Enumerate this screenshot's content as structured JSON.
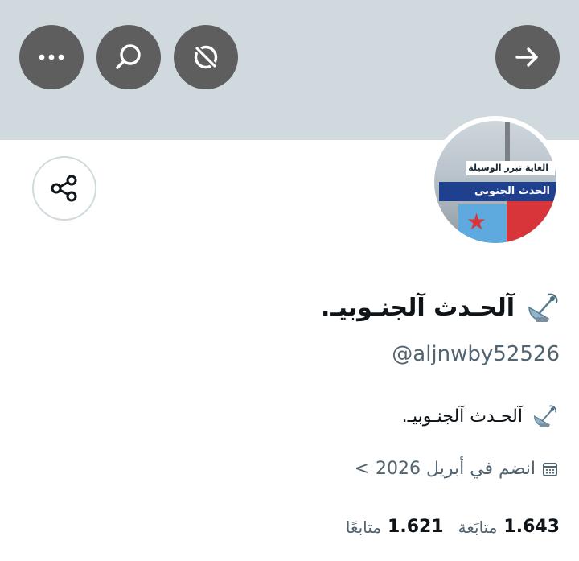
{
  "header": {
    "banner_color": "#cfd9de",
    "buttons": [
      {
        "name": "more",
        "icon": "more-horizontal-icon"
      },
      {
        "name": "search",
        "icon": "search-icon"
      },
      {
        "name": "unsubscribe",
        "icon": "circle-slash-icon"
      },
      {
        "name": "back",
        "icon": "arrow-right-icon"
      }
    ]
  },
  "share": {
    "icon": "share-icon"
  },
  "avatar": {
    "caption_top": "الغاية تبرر الوسيلة",
    "caption_main": "الحدث الجنوبي"
  },
  "profile": {
    "display_name": "آلحـدث آلجنـوبيـ.",
    "name_icon": "satellite-dish-icon",
    "handle": "@aljnwby52526",
    "bio": "آلحـدث آلجنـوبيـ.",
    "bio_icon": "satellite-dish-icon",
    "joined": "انضم في أبريل 2026",
    "joined_icon": "calendar-icon",
    "joined_chevron": "<"
  },
  "stats": {
    "following_count": "1.643",
    "following_label": "متابَعة",
    "followers_count": "1.621",
    "followers_label": "متابعًا"
  }
}
